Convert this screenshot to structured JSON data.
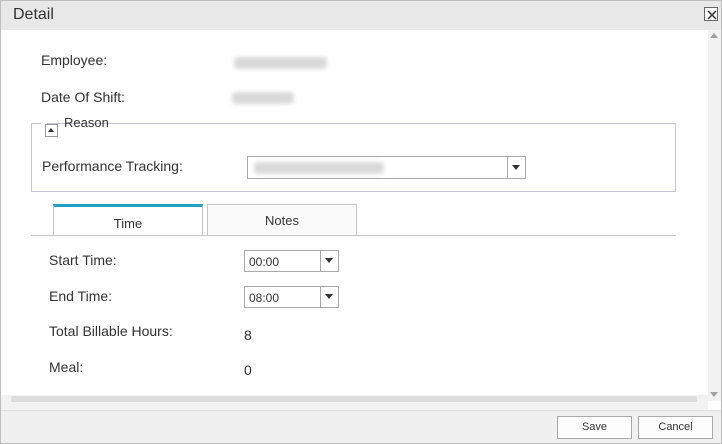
{
  "dialog": {
    "title": "Detail"
  },
  "fields": {
    "employee_label": "Employee:",
    "date_of_shift_label": "Date Of Shift:"
  },
  "reason": {
    "legend": "Reason",
    "performance_tracking_label": "Performance Tracking:"
  },
  "tabs": [
    {
      "label": "Time",
      "active": true
    },
    {
      "label": "Notes",
      "active": false
    }
  ],
  "time": {
    "start_time_label": "Start Time:",
    "start_time_value": "00:00",
    "end_time_label": "End Time:",
    "end_time_value": "08:00",
    "total_billable_hours_label": "Total Billable Hours:",
    "total_billable_hours_value": "8",
    "meal_label": "Meal:",
    "meal_value": "0"
  },
  "footer": {
    "save_label": "Save",
    "cancel_label": "Cancel"
  },
  "colors": {
    "accent": "#1fa3c4",
    "titlebar": "#e8e8e8"
  },
  "icons": {
    "close": "close-icon",
    "collapse": "collapse-arrow-icon",
    "dropdown": "chevron-down-icon"
  }
}
